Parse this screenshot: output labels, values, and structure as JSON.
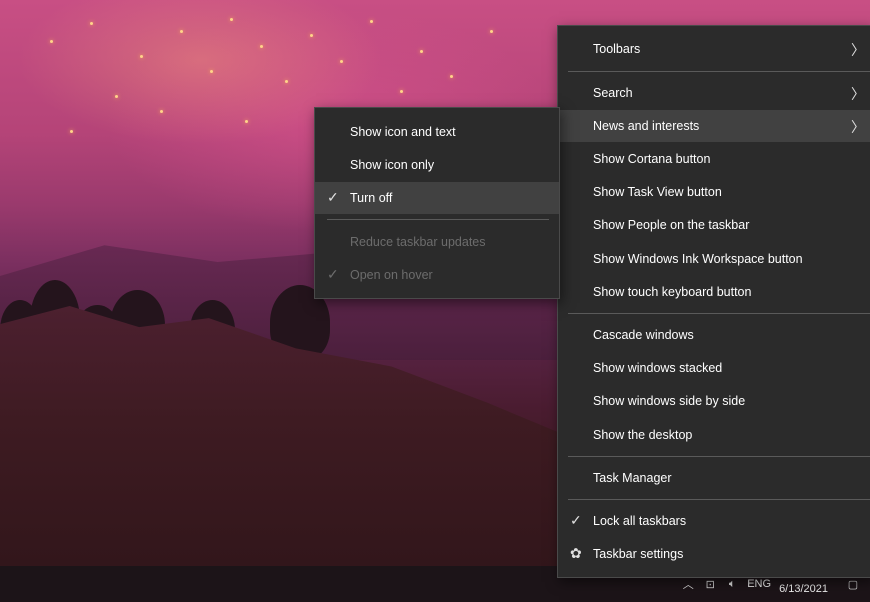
{
  "main_menu": {
    "items": [
      {
        "label": "Toolbars",
        "submenu": true
      },
      {
        "label": "Search",
        "submenu": true
      },
      {
        "label": "News and interests",
        "submenu": true,
        "highlighted": true
      },
      {
        "label": "Show Cortana button"
      },
      {
        "label": "Show Task View button"
      },
      {
        "label": "Show People on the taskbar"
      },
      {
        "label": "Show Windows Ink Workspace button"
      },
      {
        "label": "Show touch keyboard button"
      },
      {
        "label": "Cascade windows"
      },
      {
        "label": "Show windows stacked"
      },
      {
        "label": "Show windows side by side"
      },
      {
        "label": "Show the desktop"
      },
      {
        "label": "Task Manager"
      },
      {
        "label": "Lock all taskbars",
        "checked": true
      },
      {
        "label": "Taskbar settings",
        "icon": "gear-icon"
      }
    ]
  },
  "sub_menu": {
    "items": [
      {
        "label": "Show icon and text"
      },
      {
        "label": "Show icon only"
      },
      {
        "label": "Turn off",
        "checked": true,
        "highlighted": true
      },
      {
        "label": "Reduce taskbar updates",
        "disabled": true
      },
      {
        "label": "Open on hover",
        "checked": true,
        "disabled": true
      }
    ]
  },
  "taskbar": {
    "language": "ENG",
    "date": "6/13/2021",
    "icons": [
      "chevron-up-icon",
      "network-icon",
      "volume-icon",
      "notification-icon"
    ]
  },
  "glyphs": {
    "chevron": "〉",
    "check": "✓",
    "gear": "✿",
    "chevron_up": "︿",
    "network": "⊡",
    "volume": "🔈︎",
    "notification": "▢"
  }
}
